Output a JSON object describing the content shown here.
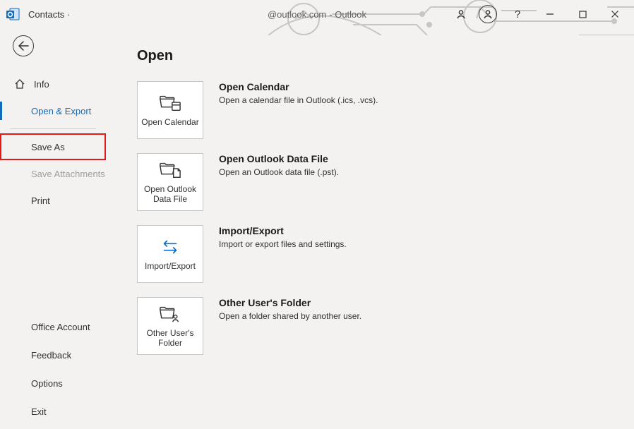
{
  "titlebar": {
    "area": "Contacts ·",
    "center_suffix": "@outlook.com",
    "center_app": "-  Outlook"
  },
  "sidebar": {
    "info": "Info",
    "open_export": "Open & Export",
    "save_as": "Save As",
    "save_attachments": "Save Attachments",
    "print": "Print"
  },
  "footer": {
    "office_account": "Office Account",
    "feedback": "Feedback",
    "options": "Options",
    "exit": "Exit"
  },
  "page": {
    "title": "Open",
    "items": [
      {
        "tile": "Open Calendar",
        "title": "Open Calendar",
        "desc": "Open a calendar file in Outlook (.ics, .vcs)."
      },
      {
        "tile": "Open Outlook Data File",
        "title": "Open Outlook Data File",
        "desc": "Open an Outlook data file (.pst)."
      },
      {
        "tile": "Import/Export",
        "title": "Import/Export",
        "desc": "Import or export files and settings."
      },
      {
        "tile": "Other User's Folder",
        "title": "Other User's Folder",
        "desc": "Open a folder shared by another user."
      }
    ]
  }
}
